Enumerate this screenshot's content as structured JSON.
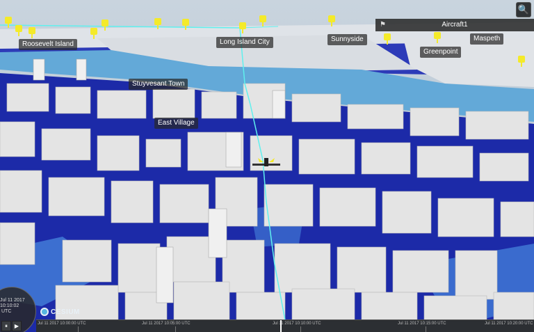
{
  "toolbar": {
    "search_icon": "search-icon",
    "search_glyph": "🔍"
  },
  "selection": {
    "name": "Aircraft1",
    "flag_glyph": "⚑"
  },
  "places": [
    {
      "label": "Roosevelt Island"
    },
    {
      "label": "Long Island City"
    },
    {
      "label": "Sunnyside"
    },
    {
      "label": "Maspeth"
    },
    {
      "label": "Greenpoint"
    },
    {
      "label": "Stuyvesant Town"
    },
    {
      "label": "East Village"
    }
  ],
  "logo": {
    "text": "CESIUM"
  },
  "clock": {
    "date": "Jul 11 2017",
    "time": "10:10:02",
    "zone": "UTC"
  },
  "controls": {
    "pause": "⏸",
    "play": "▶"
  },
  "timeline": {
    "ticks": [
      "Jul 11 2017 10:00:00 UTC",
      "Jul 11 2017 10:05:00 UTC",
      "Jul 11 2017 10:10:00 UTC",
      "Jul 11 2017 10:15:00 UTC",
      "Jul 11 2017 10:20:00 UTC"
    ]
  },
  "colors": {
    "water": "#1f2fb0",
    "river": "#5fa7d6",
    "buildings": "#e6e6e6",
    "path": "#5ff0ee",
    "markers": "#f4ea2a"
  }
}
